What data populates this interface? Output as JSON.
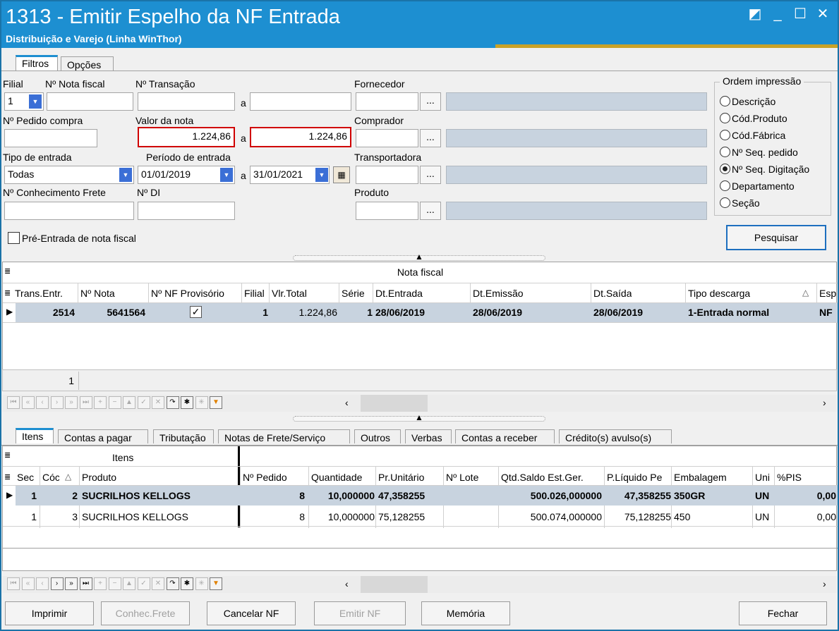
{
  "window": {
    "title": "1313 - Emitir Espelho da NF Entrada",
    "subtitle": "Distribuição e Varejo (Linha WinThor)",
    "controls": [
      "◩",
      "_",
      "☐",
      "✕"
    ]
  },
  "top_tabs": [
    "Filtros",
    "Opções"
  ],
  "filters": {
    "filial_label": "Filial",
    "filial_value": "1",
    "nota_fiscal_label": "Nº Nota fiscal",
    "transacao_label": "Nº Transação",
    "a": "a",
    "fornecedor_label": "Fornecedor",
    "pedido_compra_label": "Nº Pedido compra",
    "valor_nota_label": "Valor da nota",
    "valor_de": "1.224,86",
    "valor_ate": "1.224,86",
    "comprador_label": "Comprador",
    "tipo_entrada_label": "Tipo de entrada",
    "tipo_entrada_value": "Todas",
    "periodo_label": "Período de entrada",
    "periodo_de": "01/01/2019",
    "periodo_ate": "31/01/2021",
    "transportadora_label": "Transportadora",
    "conhecimento_label": "Nº Conhecimento Frete",
    "di_label": "Nº DI",
    "produto_label": "Produto",
    "pre_entrada_label": "Pré-Entrada de nota fiscal",
    "dots": "..."
  },
  "ordem": {
    "title": "Ordem impressão",
    "options": [
      "Descrição",
      "Cód.Produto",
      "Cód.Fábrica",
      "Nº Seq. pedido",
      "Nº Seq. Digitação",
      "Departamento",
      "Seção"
    ],
    "selected_index": 4
  },
  "pesquisar_label": "Pesquisar",
  "nf_grid": {
    "band": "Nota fiscal",
    "headers": [
      "Trans.Entr.",
      "Nº Nota",
      "Nº NF Provisório",
      "Filial",
      "Vlr.Total",
      "Série",
      "Dt.Entrada",
      "Dt.Emissão",
      "Dt.Saída",
      "Tipo descarga",
      "Esp"
    ],
    "row": {
      "trans": "2514",
      "nota": "5641564",
      "provisorio": true,
      "filial": "1",
      "total": "1.224,86",
      "serie": "1",
      "dt_entrada": "28/06/2019",
      "dt_emissao": "28/06/2019",
      "dt_saida": "28/06/2019",
      "tipo": "1-Entrada normal",
      "esp": "NF"
    },
    "footer_count": "1"
  },
  "bottom_tabs": [
    "Itens",
    "Contas a pagar",
    "Tributação",
    "Notas de Frete/Serviço",
    "Outros",
    "Verbas",
    "Contas a receber",
    "Crédito(s) avulso(s)"
  ],
  "items_grid": {
    "band": "Itens",
    "headers": [
      "Sec",
      "Cóc",
      "Produto",
      "Nº Pedido",
      "Quantidade",
      "Pr.Unitário",
      "Nº Lote",
      "Qtd.Saldo Est.Ger.",
      "P.Líquido Pe",
      "Embalagem",
      "Uni",
      "%PIS"
    ],
    "rows": [
      {
        "seq": "1",
        "cod": "2",
        "produto": "SUCRILHOS KELLOGS",
        "pedido": "8",
        "qtd": "10,000000",
        "pr": "47,358255",
        "lote": "",
        "saldo": "500.026,000000",
        "pliq": "47,358255",
        "emb": "350GR",
        "uni": "UN",
        "pis": "0,00"
      },
      {
        "seq": "1",
        "cod": "3",
        "produto": "SUCRILHOS KELLOGS",
        "pedido": "8",
        "qtd": "10,000000",
        "pr": "75,128255",
        "lote": "",
        "saldo": "500.074,000000",
        "pliq": "75,128255",
        "emb": "450",
        "uni": "UN",
        "pis": "0,00"
      }
    ]
  },
  "buttons": {
    "imprimir": "Imprimir",
    "conhec_frete": "Conhec.Frete",
    "cancelar_nf": "Cancelar NF",
    "emitir_nf": "Emitir NF",
    "memoria": "Memória",
    "fechar": "Fechar"
  }
}
